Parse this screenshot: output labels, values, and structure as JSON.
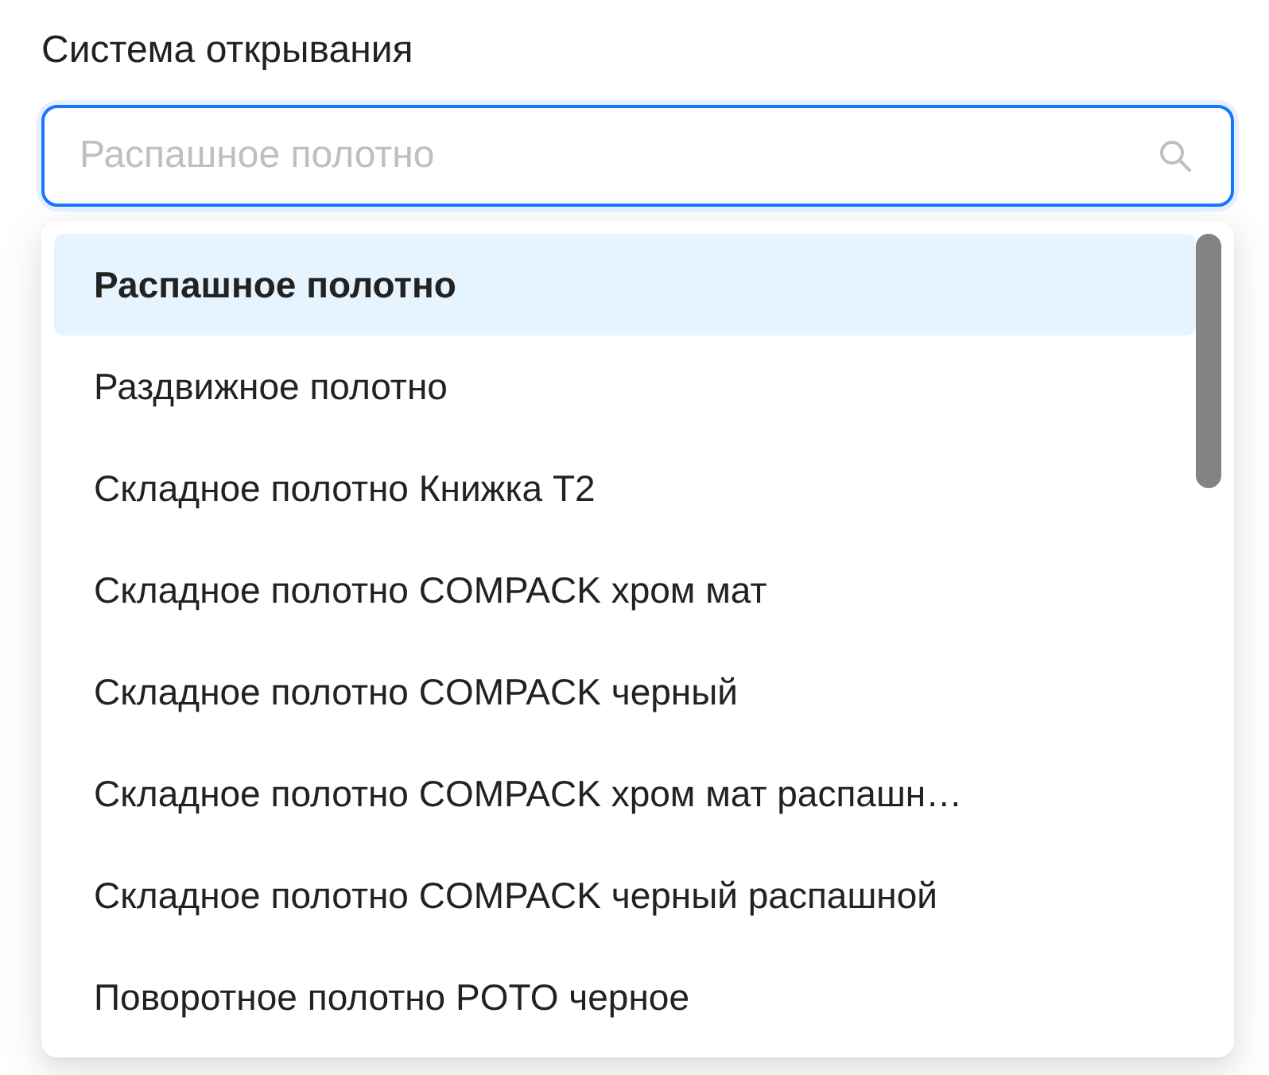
{
  "field": {
    "label": "Система открывания",
    "placeholder": "Распашное полотно"
  },
  "options": [
    {
      "text": "Распашное полотно",
      "selected": true
    },
    {
      "text": "Раздвижное полотно",
      "selected": false
    },
    {
      "text": "Складное полотно Книжка Т2",
      "selected": false
    },
    {
      "text": "Складное полотно COMPACK хром мат",
      "selected": false
    },
    {
      "text": "Складное полотно COMPACK черный",
      "selected": false
    },
    {
      "text": "Складное полотно COMPACK хром мат распашн…",
      "selected": false
    },
    {
      "text": "Складное полотно COMPACK черный распашной",
      "selected": false
    },
    {
      "text": "Поворотное полотно POTO черное",
      "selected": false
    }
  ]
}
